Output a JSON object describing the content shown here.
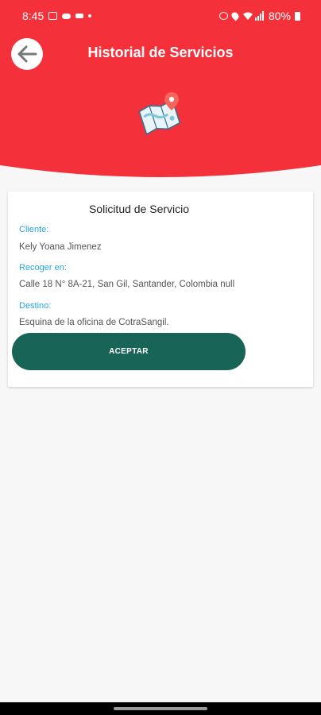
{
  "status_bar": {
    "time": "8:45",
    "battery": "80%"
  },
  "header": {
    "title": "Historial de Servicios",
    "color": "#f4313b"
  },
  "card": {
    "title": "Solicitud de Servicio",
    "cliente_label": "Cliente:",
    "cliente_value": "Kely Yoana Jimenez",
    "recoger_label": "Recoger en:",
    "recoger_value": "Calle 18 N° 8A-21, San Gil, Santander, Colombia null",
    "destino_label": "Destino:",
    "destino_value": "Esquina de la oficina de CotraSangil.",
    "accept_label": "ACEPTAR",
    "accept_color": "#186457",
    "label_color": "#27a5dc"
  }
}
